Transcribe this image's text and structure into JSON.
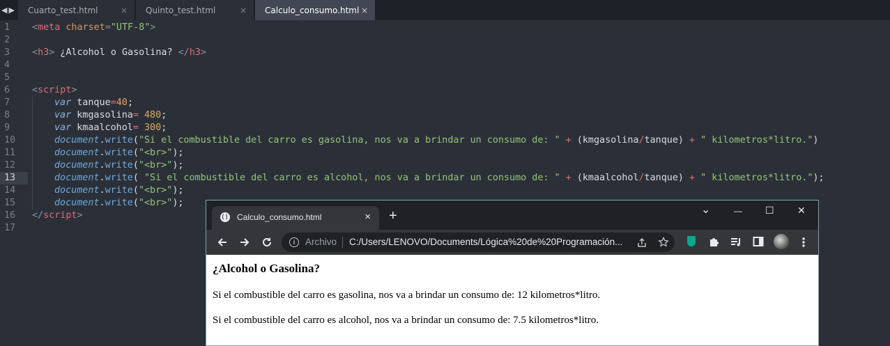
{
  "editor": {
    "tabs": [
      {
        "label": "Cuarto_test.html",
        "active": false,
        "close": "×"
      },
      {
        "label": "Quinto_test.html",
        "active": false,
        "close": "×"
      },
      {
        "label": "Calculo_consumo.html",
        "active": true,
        "close": "×"
      }
    ],
    "current_line": 13,
    "line_numbers": [
      "1",
      "2",
      "3",
      "4",
      "5",
      "6",
      "7",
      "8",
      "9",
      "10",
      "11",
      "12",
      "13",
      "14",
      "15",
      "16",
      "17"
    ],
    "code": {
      "l1_tag": "meta",
      "l1_attr": "charset",
      "l1_val": "\"UTF-8\"",
      "l3_tag": "h3",
      "l3_text": " ¿Alcohol o Gasolina? ",
      "l6_tag": "script",
      "var_kw": "var",
      "l7_name": "tanque",
      "l7_val": "40",
      "l8_name": "kmgasolina",
      "l8_val": "480",
      "l9_name": "kmaalcohol",
      "l9_val": "300",
      "doc": "document",
      "write": "write",
      "l10_str1": "\"Si el combustible del carro es gasolina, nos va a brindar un consumo de: \"",
      "l10_num": "kmgasolina",
      "l10_den": "tanque",
      "str_end": "\" kilometros*litro.\"",
      "br_str": "\"<br>\"",
      "l13_str1": "\"Si el combustible del carro es alcohol, nos va a brindar un consumo de: \"",
      "l13_num": "kmaalcohol",
      "l13_den": "tanque"
    }
  },
  "browser": {
    "tab_title": "Calculo_consumo.html",
    "tab_close": "×",
    "new_tab": "+",
    "controls": {
      "minimize": "—",
      "maximize": "☐",
      "close": "✕",
      "dropdown": "⌄"
    },
    "address": {
      "scheme_label": "Archivo",
      "url": "C:/Users/LENOVO/Documents/Lógica%20de%20Programación..."
    },
    "icons": [
      "back-icon",
      "forward-icon",
      "reload-icon",
      "info-icon",
      "share-icon",
      "bookmark-star-icon",
      "shield-extension-icon",
      "extensions-puzzle-icon",
      "media-queue-icon",
      "side-panel-icon",
      "profile-avatar",
      "menu-kebab-icon"
    ],
    "page": {
      "heading": "¿Alcohol o Gasolina?",
      "line1": "Si el combustible del carro es gasolina, nos va a brindar un consumo de: 12 kilometros*litro.",
      "line2": "Si el combustible del carro es alcohol, nos va a brindar un consumo de: 7.5 kilometros*litro."
    }
  }
}
